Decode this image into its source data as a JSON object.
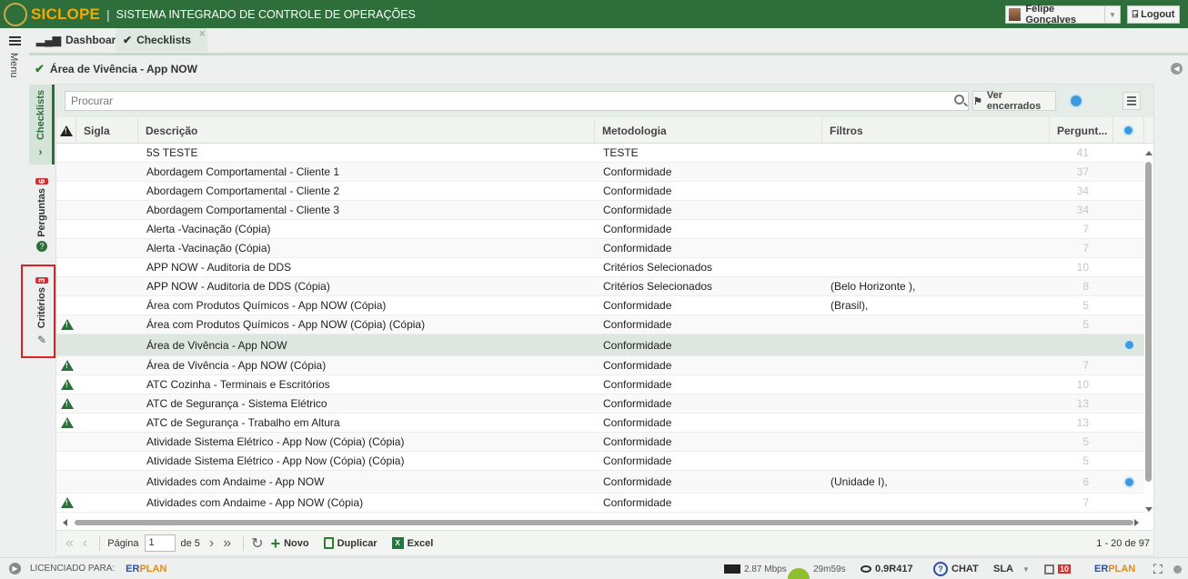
{
  "header": {
    "brand": "SICLOPE",
    "subtitle": "SISTEMA INTEGRADO DE CONTROLE DE OPERAÇÕES",
    "user": "Felipe Gonçalves",
    "logout": "Logout"
  },
  "tabs": [
    {
      "label": "Dashboard"
    },
    {
      "label": "Checklists"
    }
  ],
  "menu_label": "Menu",
  "breadcrumb": "Área de Vivência - App NOW",
  "side_tabs": {
    "checklists": "Checklists",
    "perguntas": "Perguntas",
    "perguntas_count": "6",
    "criterios": "Critérios",
    "criterios_count": "3"
  },
  "toolbar": {
    "search_placeholder": "Procurar",
    "ver_encerrados": "Ver encerrados"
  },
  "columns": {
    "sigla": "Sigla",
    "descricao": "Descrição",
    "metodologia": "Metodologia",
    "filtros": "Filtros",
    "perguntas": "Pergunt..."
  },
  "rows": [
    {
      "warn": false,
      "desc": "5S TESTE",
      "met": "TESTE",
      "fil": "",
      "perg": "41",
      "stat": false
    },
    {
      "warn": false,
      "desc": "Abordagem Comportamental - Cliente 1",
      "met": "Conformidade",
      "fil": "",
      "perg": "37",
      "stat": false
    },
    {
      "warn": false,
      "desc": "Abordagem Comportamental - Cliente 2",
      "met": "Conformidade",
      "fil": "",
      "perg": "34",
      "stat": false
    },
    {
      "warn": false,
      "desc": "Abordagem Comportamental - Cliente 3",
      "met": "Conformidade",
      "fil": "",
      "perg": "34",
      "stat": false
    },
    {
      "warn": false,
      "desc": "Alerta -Vacinação (Cópia)",
      "met": "Conformidade",
      "fil": "",
      "perg": "7",
      "stat": false
    },
    {
      "warn": false,
      "desc": "Alerta -Vacinação (Cópia)",
      "met": "Conformidade",
      "fil": "",
      "perg": "7",
      "stat": false
    },
    {
      "warn": false,
      "desc": "APP NOW - Auditoria de DDS",
      "met": "Critérios Selecionados",
      "fil": "",
      "perg": "10",
      "stat": false
    },
    {
      "warn": false,
      "desc": "APP NOW - Auditoria de DDS  (Cópia)",
      "met": "Critérios Selecionados",
      "fil": "(Belo Horizonte ),",
      "perg": "8",
      "stat": false
    },
    {
      "warn": false,
      "desc": "Área com Produtos Químicos - App NOW (Cópia)",
      "met": "Conformidade",
      "fil": "(Brasil),",
      "perg": "5",
      "stat": false
    },
    {
      "warn": true,
      "desc": "Área com Produtos Químicos - App NOW (Cópia) (Cópia)",
      "met": "Conformidade",
      "fil": "",
      "perg": "5",
      "stat": false
    },
    {
      "warn": false,
      "desc": "Área de Vivência - App NOW",
      "met": "Conformidade",
      "fil": "",
      "perg": "",
      "stat": true,
      "selected": true
    },
    {
      "warn": true,
      "desc": "Área de Vivência - App NOW (Cópia)",
      "met": "Conformidade",
      "fil": "",
      "perg": "7",
      "stat": false
    },
    {
      "warn": true,
      "desc": "ATC Cozinha - Terminais e Escritórios",
      "met": "Conformidade",
      "fil": "",
      "perg": "10",
      "stat": false
    },
    {
      "warn": true,
      "desc": "ATC de Segurança - Sistema Elétrico",
      "met": "Conformidade",
      "fil": "",
      "perg": "13",
      "stat": false
    },
    {
      "warn": true,
      "desc": "ATC de Segurança - Trabalho em Altura",
      "met": "Conformidade",
      "fil": "",
      "perg": "13",
      "stat": false
    },
    {
      "warn": false,
      "desc": "Atividade Sistema Elétrico - App Now (Cópia) (Cópia)",
      "met": "Conformidade",
      "fil": "",
      "perg": "5",
      "stat": false
    },
    {
      "warn": false,
      "desc": "Atividade Sistema Elétrico - App Now (Cópia) (Cópia)",
      "met": "Conformidade",
      "fil": "",
      "perg": "5",
      "stat": false
    },
    {
      "warn": false,
      "desc": "Atividades com Andaime -  App NOW",
      "met": "Conformidade",
      "fil": "(Unidade I),",
      "perg": "6",
      "stat": true
    },
    {
      "warn": true,
      "desc": "Atividades com Andaime -  App NOW (Cópia)",
      "met": "Conformidade",
      "fil": "",
      "perg": "7",
      "stat": false
    }
  ],
  "pager": {
    "page_label": "Página",
    "page_value": "1",
    "of_label": "de 5",
    "novo": "Novo",
    "duplicar": "Duplicar",
    "excel": "Excel",
    "count": "1 - 20 de 97"
  },
  "footer": {
    "licensed": "LICENCIADO PARA:",
    "erplan_a": "ER",
    "erplan_b": "PLAN",
    "speed": "2.87 Mbps",
    "timer": "29m59s",
    "version": "0.9R417",
    "chat": "CHAT",
    "sla": "SLA",
    "notif_count": "10"
  }
}
